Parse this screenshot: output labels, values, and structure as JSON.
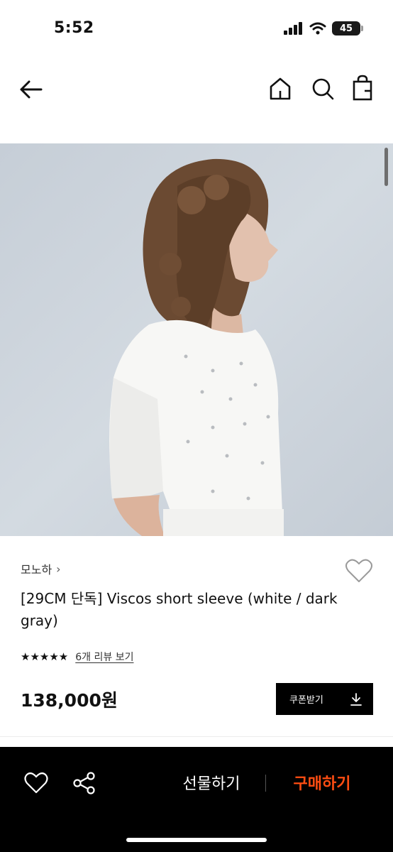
{
  "status_bar": {
    "time": "5:52",
    "battery": "45",
    "icons": [
      "signal-icon",
      "wifi-icon",
      "battery-icon"
    ]
  },
  "nav": {
    "icons": [
      "back-arrow-icon",
      "home-icon",
      "search-icon",
      "shopping-bag-icon"
    ]
  },
  "hero": {
    "image_subject": "model with curly hair in white short-sleeve top against pale blue wall"
  },
  "product": {
    "brand": "모노하",
    "brand_chevron": "›",
    "title": "[29CM 단독] Viscos short sleeve (white / dark gray)",
    "rating_stars": "★★★★★",
    "rating_value": 5,
    "review_link": "6개 리뷰 보기",
    "price": "138,000원"
  },
  "coupon": {
    "label": "쿠폰받기",
    "icon": "download-icon"
  },
  "actions": {
    "like_icon": "heart-icon",
    "share_icon": "share-icon",
    "gift_label": "선물하기",
    "buy_label": "구매하기"
  },
  "colors": {
    "buy_accent": "#ff4d12",
    "action_bar_bg": "#000000",
    "coupon_bg": "#000000"
  }
}
